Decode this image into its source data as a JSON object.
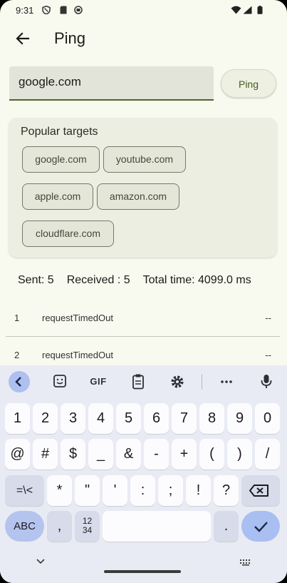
{
  "status_bar": {
    "time": "9:31"
  },
  "app_bar": {
    "title": "Ping"
  },
  "input": {
    "value": "google.com"
  },
  "ping_button": {
    "label": "Ping"
  },
  "popular": {
    "title": "Popular targets",
    "targets": [
      "google.com",
      "youtube.com",
      "apple.com",
      "amazon.com",
      "cloudflare.com"
    ]
  },
  "stats": {
    "sent": "Sent: 5",
    "received": "Received : 5",
    "total": "Total time: 4099.0 ms"
  },
  "results": [
    {
      "seq": "1",
      "status": "requestTimedOut",
      "time": "--"
    },
    {
      "seq": "2",
      "status": "requestTimedOut",
      "time": "--"
    }
  ],
  "keyboard": {
    "toolbar": {
      "gif": "GIF"
    },
    "row1": [
      "1",
      "2",
      "3",
      "4",
      "5",
      "6",
      "7",
      "8",
      "9",
      "0"
    ],
    "row2": [
      "@",
      "#",
      "$",
      "_",
      "&",
      "-",
      "+",
      "(",
      ")",
      "/"
    ],
    "row3": {
      "shift": "=\\<",
      "keys": [
        "*",
        "\"",
        "'",
        ":",
        ";",
        "!",
        "?"
      ]
    },
    "row4": {
      "abc": "ABC",
      "comma": ",",
      "numpad_top": "12",
      "numpad_bottom": "34",
      "period": "."
    }
  }
}
